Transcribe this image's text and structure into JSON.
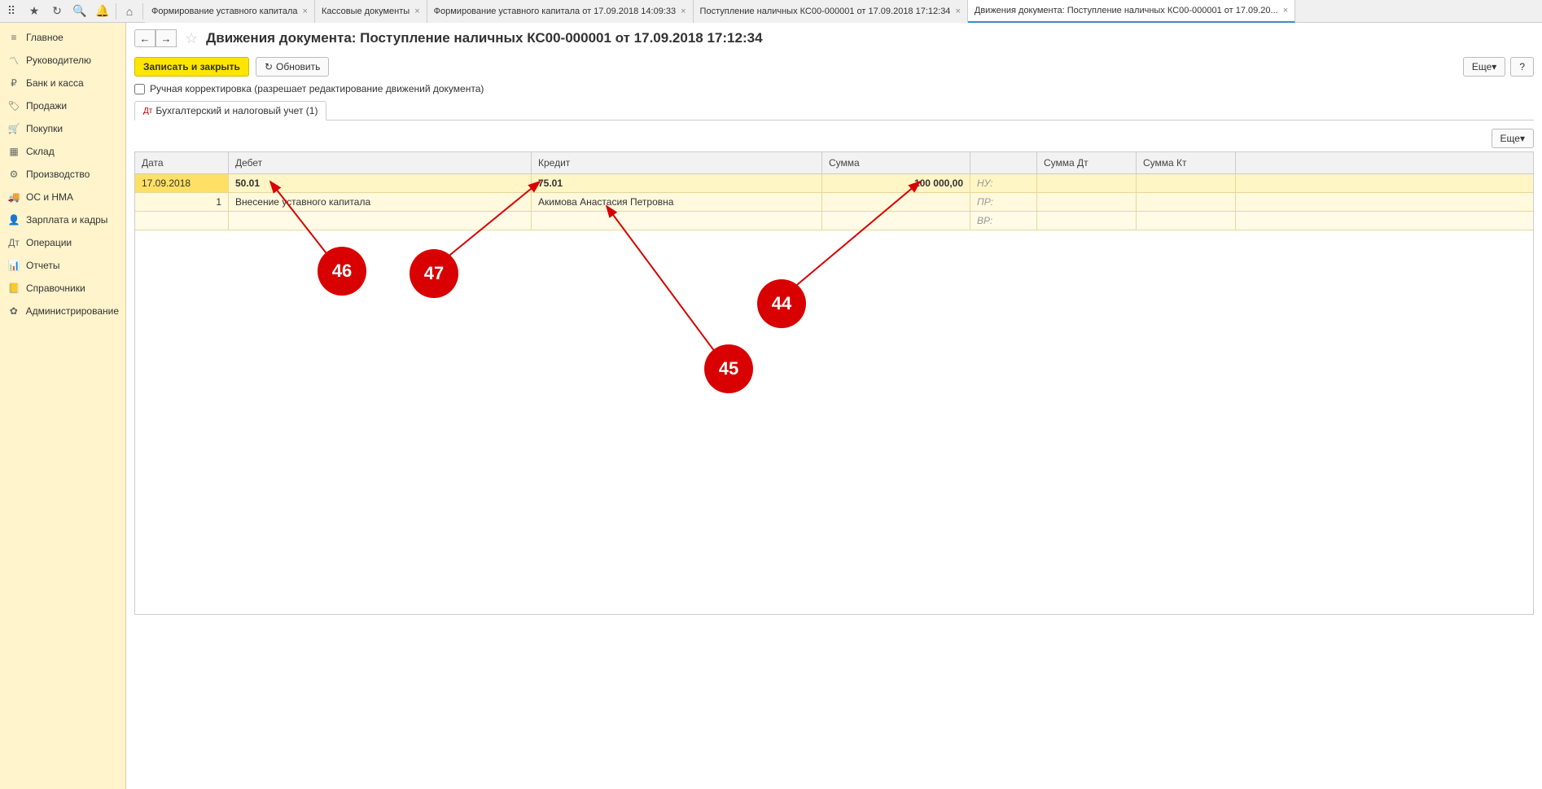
{
  "tabs": [
    "Формирование уставного капитала",
    "Кассовые документы",
    "Формирование уставного капитала от 17.09.2018 14:09:33",
    "Поступление наличных КС00-000001 от 17.09.2018 17:12:34",
    "Движения документа: Поступление наличных КС00-000001 от 17.09.20..."
  ],
  "sidebar": [
    "Главное",
    "Руководителю",
    "Банк и касса",
    "Продажи",
    "Покупки",
    "Склад",
    "Производство",
    "ОС и НМА",
    "Зарплата и кадры",
    "Операции",
    "Отчеты",
    "Справочники",
    "Администрирование"
  ],
  "page_title": "Движения документа: Поступление наличных КС00-000001 от 17.09.2018 17:12:34",
  "buttons": {
    "save_close": "Записать и закрыть",
    "refresh": "Обновить",
    "more": "Еще",
    "help": "?"
  },
  "checkbox_label": "Ручная корректировка (разрешает редактирование движений документа)",
  "sub_tab": "Бухгалтерский и налоговый учет (1)",
  "grid_headers": {
    "date": "Дата",
    "debit": "Дебет",
    "credit": "Кредит",
    "sum": "Сумма",
    "sum_dt": "Сумма Дт",
    "sum_kt": "Сумма Кт"
  },
  "row": {
    "date": "17.09.2018",
    "number": "1",
    "debit_account": "50.01",
    "debit_desc": "Внесение уставного капитала",
    "credit_account": "75.01",
    "credit_desc": "Акимова Анастасия Петровна",
    "sum": "100 000,00",
    "labels": {
      "nu": "НУ:",
      "pr": "ПР:",
      "vr": "ВР:"
    }
  },
  "annotations": {
    "b44": "44",
    "b45": "45",
    "b46": "46",
    "b47": "47"
  }
}
